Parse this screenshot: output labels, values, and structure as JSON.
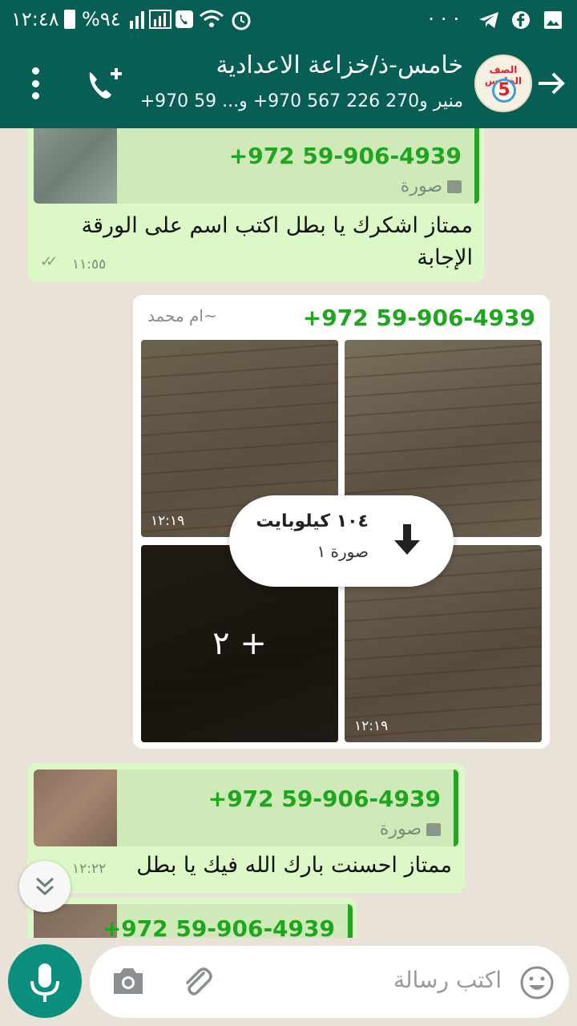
{
  "status_bar": {
    "time": "١٢:٤٨",
    "battery_percent": "%٩٤"
  },
  "header": {
    "title": "خامس-ذ/خزاعة الاعدادية",
    "subtitle": "منير و270 226 567 970+ و... 59 970+",
    "avatar_text": "الصف الخامس",
    "avatar_number": "5"
  },
  "messages": [
    {
      "direction": "out",
      "quote_sender": "+972 59-906-4939",
      "quote_type": "صورة",
      "text": "ممتاز اشكرك يا بطل اكتب اسم على الورقة الإجابة",
      "time": "١١:٥٥"
    },
    {
      "direction": "in",
      "sender": "+972 59-906-4939",
      "sender_name": "~ام محمد",
      "photos": [
        {
          "time": "١٢:١٩"
        },
        {
          "time": ""
        },
        {
          "time": ""
        },
        {
          "time": "١٢:١٩"
        }
      ],
      "more_count": "٢ +",
      "download_size": "١٠٤ كيلوبايت",
      "download_count": "صورة ١"
    },
    {
      "direction": "out",
      "quote_sender": "+972 59-906-4939",
      "quote_type": "صورة",
      "text": "ممتاز احسنت بارك الله فيك يا بطل",
      "time": "١٢:٢٢"
    },
    {
      "direction": "out",
      "quote_sender": "+972 59-906-4939"
    }
  ],
  "composer": {
    "placeholder": "اكتب رسالة"
  },
  "colors": {
    "header": "#075e54",
    "out_bubble": "#dcf8c6",
    "in_bubble": "#ffffff",
    "quote_accent": "#1fa61f",
    "mic": "#0a8f7f"
  }
}
